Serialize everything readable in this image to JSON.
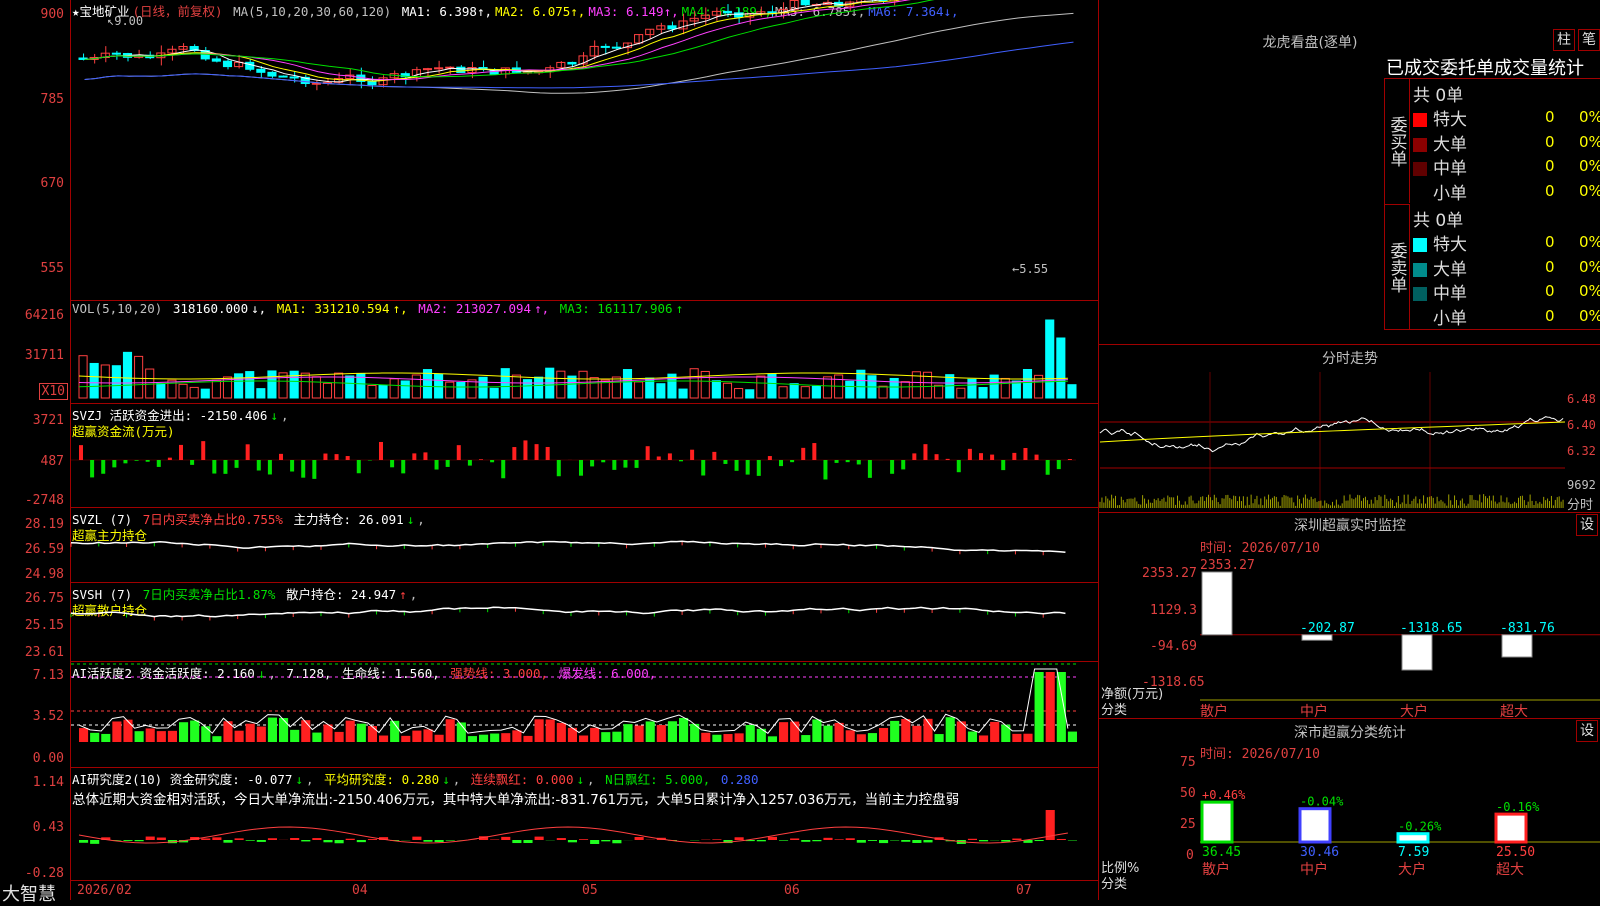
{
  "app": {
    "brand": "大智慧",
    "stock_title": "★宝地矿业",
    "period_tag": "(日线，前复权)"
  },
  "main_header": {
    "ma_label": "MA(5,10,20,30,60,120)",
    "items": [
      {
        "label": "MA1:",
        "value": "6.398",
        "arrow": "↑",
        "color": "#ffffff"
      },
      {
        "label": "MA2:",
        "value": "6.075",
        "arrow": "↑",
        "color": "#ffff00"
      },
      {
        "label": "MA3:",
        "value": "6.149",
        "arrow": "↑",
        "color": "#ff40ff"
      },
      {
        "label": "MA4:",
        "value": "6.189",
        "arrow": "↓",
        "color": "#00e000"
      },
      {
        "label": "MA5:",
        "value": "6.785",
        "arrow": "↓",
        "color": "#c0c0c0"
      },
      {
        "label": "MA6:",
        "value": "7.364",
        "arrow": "↓",
        "color": "#4060ff"
      }
    ]
  },
  "main_axis": [
    "900",
    "785",
    "670",
    "555"
  ],
  "main_annotations": {
    "high": "9.00",
    "low": "5.55"
  },
  "vol_panel": {
    "header": "VOL(5,10,20)",
    "value": "318160.000",
    "ma1": "MA1: 331210.594",
    "ma2": "MA2: 213027.094",
    "ma3": "MA3: 161117.906",
    "axis": [
      "64216",
      "31711"
    ],
    "unit": "X10"
  },
  "svzj_panel": {
    "header": "SVZJ  活跃资金进出: -2150.406",
    "subtitle": "超赢资金流(万元)",
    "axis": [
      "3721",
      "487",
      "-2748"
    ]
  },
  "svzl_panel": {
    "header": "SVZL (7)",
    "tip": "7日内买卖净占比0.755%",
    "hold": "主力持仓: 26.091",
    "subtitle": "超赢主力持仓",
    "axis": [
      "28.19",
      "26.59",
      "24.98"
    ]
  },
  "svsh_panel": {
    "header": "SVSH (7)",
    "tip": "7日内买卖净占比1.87%",
    "hold": "散户持仓: 24.947",
    "subtitle": "超赢散户持仓",
    "axis": [
      "26.75",
      "25.15",
      "23.61"
    ]
  },
  "ai_panel": {
    "header": "AI活跃度2 资金活跃度: 2.160",
    "v2": "7.128,",
    "life": "生命线: 1.560,",
    "strong": "强势线: 3.000,",
    "burst": "爆发线: 6.000,",
    "axis": [
      "7.13",
      "3.52",
      "0.00"
    ]
  },
  "ai2_panel": {
    "header": "AI研究度2(10) 资金研究度: -0.077",
    "avg": "平均研究度: 0.280",
    "red": "连续飘红: 0.000",
    "nday": "N日飘红: 5.000,",
    "extra": "0.280",
    "summary": "总体近期大资金相对活跃，今日大单净流出:-2150.406万元，其中特大单净流出:-831.761万元，大单5日累计净入1257.036万元，当前主力控盘弱",
    "axis": [
      "1.14",
      "0.43",
      "-0.28"
    ]
  },
  "date_axis": [
    "2026/02",
    "04",
    "05",
    "06",
    "07"
  ],
  "dragon": {
    "title": "龙虎看盘(逐单)",
    "tabs": [
      "柱",
      "笔"
    ],
    "subtitle": "已成交委托单成交量统计",
    "buy_label": "委买单",
    "sell_label": "委卖单",
    "buy_total": "共 0单",
    "sell_total": "共 0单",
    "buy_rows": [
      {
        "name": "特大",
        "count": "0",
        "pct": "0%",
        "color": "#ff0000"
      },
      {
        "name": "大单",
        "count": "0",
        "pct": "0%",
        "color": "#8b0000"
      },
      {
        "name": "中单",
        "count": "0",
        "pct": "0%",
        "color": "#600000"
      },
      {
        "name": "小单",
        "count": "0",
        "pct": "0%",
        "color": "#000000"
      }
    ],
    "sell_rows": [
      {
        "name": "特大",
        "count": "0",
        "pct": "0%",
        "color": "#00ffff"
      },
      {
        "name": "大单",
        "count": "0",
        "pct": "0%",
        "color": "#008b8b"
      },
      {
        "name": "中单",
        "count": "0",
        "pct": "0%",
        "color": "#006060"
      },
      {
        "name": "小单",
        "count": "0",
        "pct": "0%",
        "color": "#000000"
      }
    ]
  },
  "intraday": {
    "title": "分时走势",
    "price_axis": [
      "6.48",
      "6.40",
      "6.32"
    ],
    "vol_top": "9692",
    "vol_label": "分时"
  },
  "monitor": {
    "title": "深圳超赢实时监控",
    "btn": "设",
    "time": "时间: 2026/07/10",
    "axis": [
      "2353.27",
      "1129.3",
      "-94.69",
      "-1318.65"
    ],
    "axis_title": "净额(万元)",
    "axis_sub": "分类",
    "categories": [
      "散户",
      "中户",
      "大户",
      "超大"
    ],
    "values": [
      2353.27,
      -202.87,
      -1318.65,
      -831.76
    ],
    "value_labels": [
      "2353.27",
      "-202.87",
      "-1318.65",
      "-831.76"
    ]
  },
  "classify": {
    "title": "深市超赢分类统计",
    "btn": "设",
    "time": "时间: 2026/07/10",
    "axis": [
      "75",
      "50",
      "25",
      "0"
    ],
    "axis_title": "比例%",
    "axis_sub": "分类",
    "categories": [
      "散户",
      "中户",
      "大户",
      "超大"
    ],
    "values": [
      36.45,
      30.46,
      7.59,
      25.5
    ],
    "value_labels": [
      "36.45",
      "30.46",
      "7.59",
      "25.50"
    ],
    "changes": [
      "+0.46%",
      "-0.04%",
      "-0.26%",
      "-0.16%"
    ]
  },
  "chart_data": [
    {
      "type": "bar",
      "title": "深圳超赢实时监控",
      "categories": [
        "散户",
        "中户",
        "大户",
        "超大"
      ],
      "values": [
        2353.27,
        -202.87,
        -1318.65,
        -831.76
      ],
      "ylabel": "净额(万元)",
      "ylim": [
        -1318.65,
        2353.27
      ]
    },
    {
      "type": "bar",
      "title": "深市超赢分类统计",
      "categories": [
        "散户",
        "中户",
        "大户",
        "超大"
      ],
      "values": [
        36.45,
        30.46,
        7.59,
        25.5
      ],
      "ylabel": "比例%",
      "ylim": [
        0,
        75
      ]
    }
  ]
}
